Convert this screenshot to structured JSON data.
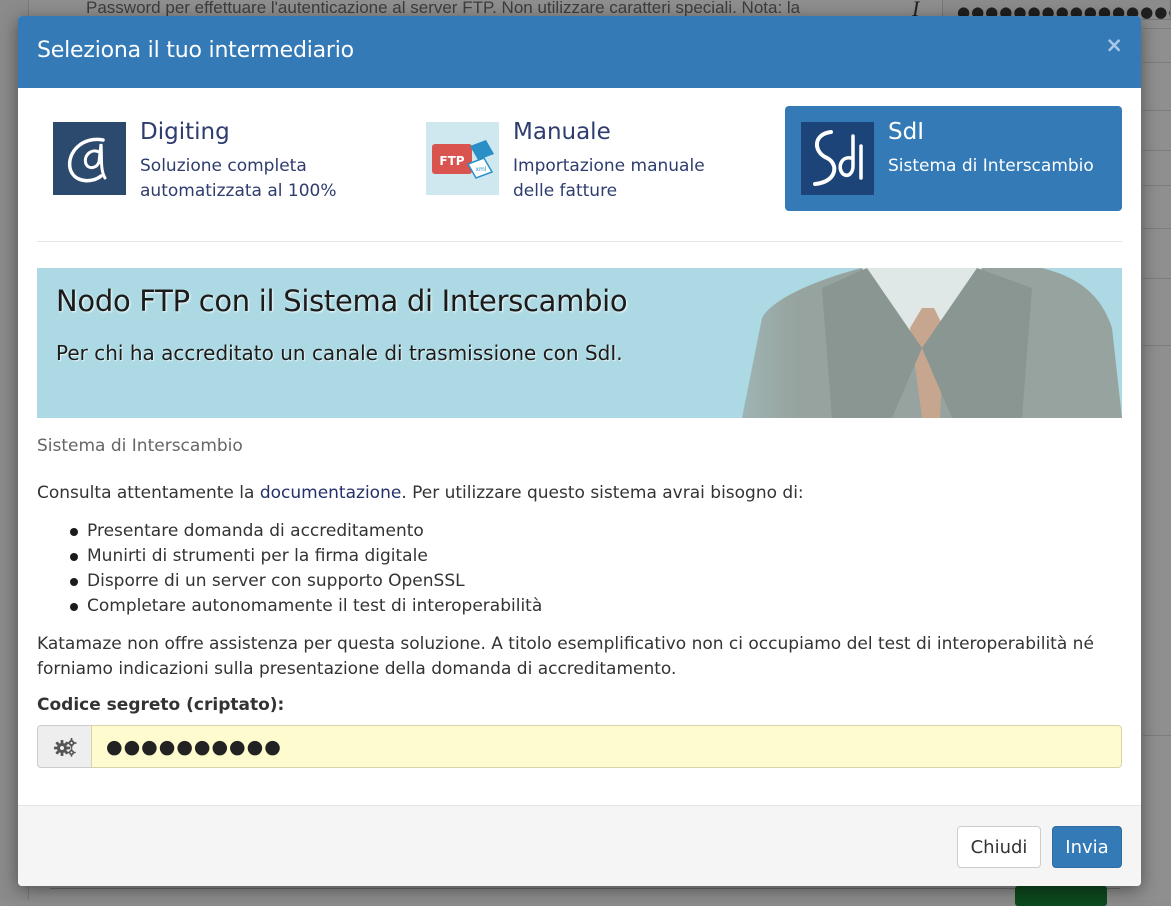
{
  "background": {
    "help_text": "Password per effettuare l'autenticazione al server FTP. Non utilizzare caratteri speciali. Nota: la",
    "password_mask": "●●●●●●●●●●●●●●●●●●"
  },
  "modal": {
    "title": "Seleziona il tuo intermediario",
    "close_label": "×",
    "providers": [
      {
        "name": "Digiting",
        "description_line1": "Soluzione completa",
        "description_line2": "automatizzata al 100%",
        "icon": "digiting-logo",
        "selected": false
      },
      {
        "name": "Manuale",
        "description_line1": "Importazione manuale",
        "description_line2": "delle fatture",
        "icon": "ftp-xml-logo",
        "selected": false
      },
      {
        "name": "SdI",
        "description_line1": "Sistema di Interscambio",
        "description_line2": "",
        "icon": "sdi-logo",
        "selected": true
      }
    ],
    "hero": {
      "title": "Nodo FTP con il Sistema di Interscambio",
      "subtitle": "Per chi ha accreditato un canale di trasmissione con SdI."
    },
    "section_label": "Sistema di Interscambio",
    "intro": {
      "prefix": "Consulta attentamente la ",
      "link": "documentazione",
      "suffix": ". Per utilizzare questo sistema avrai bisogno di:"
    },
    "requirements": [
      "Presentare domanda di accreditamento",
      "Munirti di strumenti per la firma digitale",
      "Disporre di un server con supporto OpenSSL",
      "Completare autonomamente il test di interoperabilità"
    ],
    "note": "Katamaze non offre assistenza per questa soluzione. A titolo esemplificativo non ci occupiamo del test di interoperabilità né forniamo indicazioni sulla presentazione della domanda di accreditamento.",
    "secret_field": {
      "label": "Codice segreto (criptato):",
      "value": "●●●●●●●●●●",
      "icon": "gears-icon"
    },
    "footer": {
      "close_button": "Chiudi",
      "submit_button": "Invia"
    }
  },
  "colors": {
    "primary": "#337ab7",
    "input_highlight": "#fefccf",
    "hero_bg": "#acd9e3",
    "text_dark_blue": "#2e3c6e"
  }
}
